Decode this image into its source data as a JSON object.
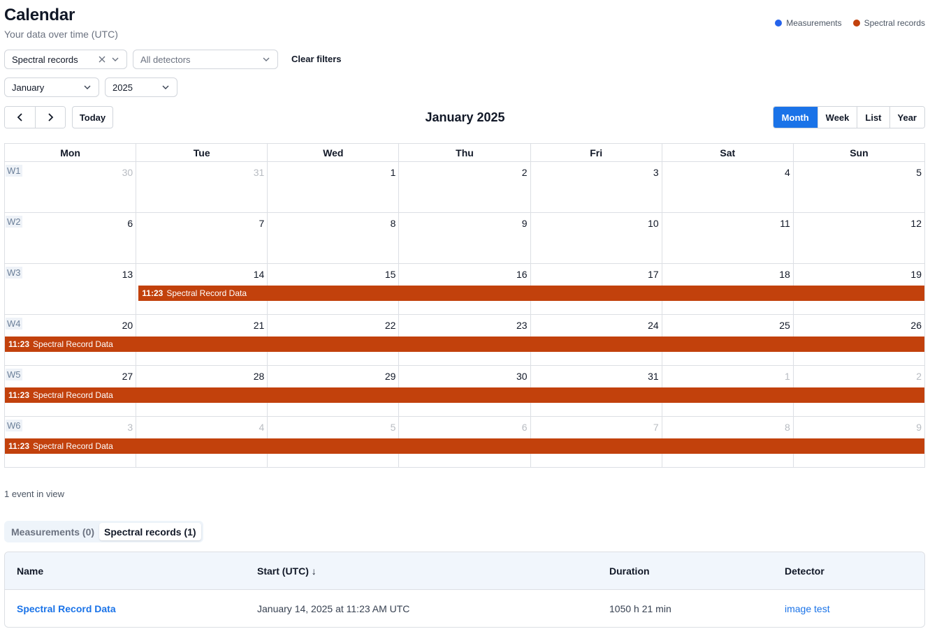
{
  "header": {
    "title": "Calendar",
    "subtitle": "Your data over time (UTC)"
  },
  "legend": [
    {
      "label": "Measurements",
      "color": "#2563eb"
    },
    {
      "label": "Spectral records",
      "color": "#c2410c"
    }
  ],
  "filters": {
    "type_value": "Spectral records",
    "detector_placeholder": "All detectors",
    "clear_label": "Clear filters",
    "month_value": "January",
    "year_value": "2025"
  },
  "toolbar": {
    "today_label": "Today",
    "title": "January 2025",
    "views": [
      "Month",
      "Week",
      "List",
      "Year"
    ],
    "active_view": "Month"
  },
  "calendar": {
    "weekdays": [
      "Mon",
      "Tue",
      "Wed",
      "Thu",
      "Fri",
      "Sat",
      "Sun"
    ],
    "weeks": [
      {
        "label": "W1",
        "days": [
          {
            "n": "30",
            "other": true
          },
          {
            "n": "31",
            "other": true
          },
          {
            "n": "1"
          },
          {
            "n": "2"
          },
          {
            "n": "3"
          },
          {
            "n": "4"
          },
          {
            "n": "5"
          }
        ]
      },
      {
        "label": "W2",
        "days": [
          {
            "n": "6"
          },
          {
            "n": "7"
          },
          {
            "n": "8"
          },
          {
            "n": "9"
          },
          {
            "n": "10"
          },
          {
            "n": "11"
          },
          {
            "n": "12"
          }
        ]
      },
      {
        "label": "W3",
        "days": [
          {
            "n": "13"
          },
          {
            "n": "14"
          },
          {
            "n": "15"
          },
          {
            "n": "16"
          },
          {
            "n": "17"
          },
          {
            "n": "18"
          },
          {
            "n": "19"
          }
        ],
        "event": {
          "time": "11:23",
          "title": "Spectral Record Data",
          "start_day": 1
        }
      },
      {
        "label": "W4",
        "days": [
          {
            "n": "20"
          },
          {
            "n": "21"
          },
          {
            "n": "22"
          },
          {
            "n": "23"
          },
          {
            "n": "24"
          },
          {
            "n": "25"
          },
          {
            "n": "26"
          }
        ],
        "event": {
          "time": "11:23",
          "title": "Spectral Record Data",
          "start_day": 0
        }
      },
      {
        "label": "W5",
        "days": [
          {
            "n": "27"
          },
          {
            "n": "28"
          },
          {
            "n": "29"
          },
          {
            "n": "30"
          },
          {
            "n": "31"
          },
          {
            "n": "1",
            "other": true
          },
          {
            "n": "2",
            "other": true
          }
        ],
        "event": {
          "time": "11:23",
          "title": "Spectral Record Data",
          "start_day": 0
        }
      },
      {
        "label": "W6",
        "days": [
          {
            "n": "3",
            "other": true
          },
          {
            "n": "4",
            "other": true
          },
          {
            "n": "5",
            "other": true
          },
          {
            "n": "6",
            "other": true
          },
          {
            "n": "7",
            "other": true
          },
          {
            "n": "8",
            "other": true
          },
          {
            "n": "9",
            "other": true
          }
        ],
        "event": {
          "time": "11:23",
          "title": "Spectral Record Data",
          "start_day": 0
        }
      }
    ],
    "event_color": "#c2410c"
  },
  "summary": {
    "count_text": "1 event in view"
  },
  "tabs": [
    {
      "label": "Measurements (0)",
      "active": false
    },
    {
      "label": "Spectral records (1)",
      "active": true
    }
  ],
  "table": {
    "columns": [
      "Name",
      "Start (UTC) ↓",
      "Duration",
      "Detector"
    ],
    "rows": [
      {
        "name": "Spectral Record Data",
        "start": "January 14, 2025 at 11:23 AM UTC",
        "duration": "1050 h 21 min",
        "detector": "image test"
      }
    ]
  }
}
